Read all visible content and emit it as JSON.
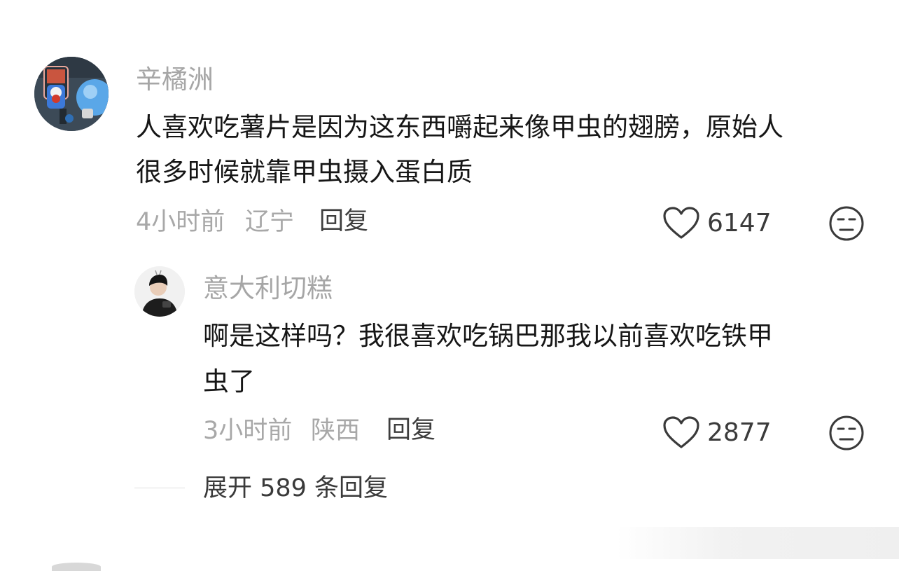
{
  "comment": {
    "username": "辛橘洲",
    "text_lines": [
      "人喜欢吃薯片是因为这东西嚼起来像甲虫的翅膀，原始人",
      "很多时候就靠甲虫摄入蛋白质"
    ],
    "time": "4小时前",
    "location": "辽宁",
    "reply_label": "回复",
    "likes": "6147",
    "avatar_icon": "cartoon-avatar",
    "like_icon": "heart-outline-icon",
    "reaction_icon": "neutral-face-icon"
  },
  "reply": {
    "username": "意大利切糕",
    "text_lines": [
      "啊是这样吗？我很喜欢吃锅巴那我以前喜欢吃铁甲",
      "虫了"
    ],
    "time": "3小时前",
    "location": "陕西",
    "reply_label": "回复",
    "likes": "2877",
    "avatar_icon": "photo-avatar",
    "like_icon": "heart-outline-icon",
    "reaction_icon": "neutral-face-icon"
  },
  "expand": {
    "label": "展开 589 条回复"
  },
  "colors": {
    "text_primary": "#161616",
    "text_muted": "#a6a6a6",
    "text_action": "#3d3d3d",
    "background": "#ffffff"
  }
}
